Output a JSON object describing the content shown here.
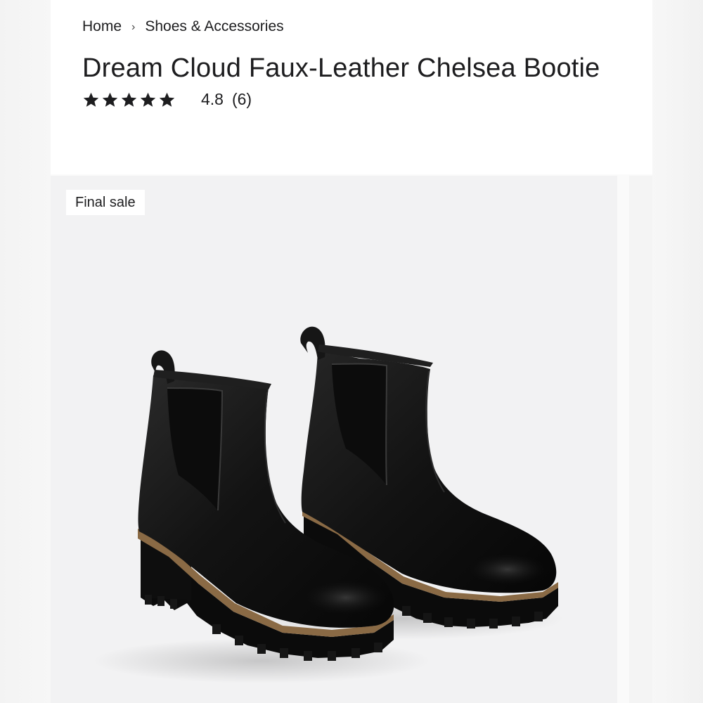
{
  "breadcrumb": {
    "items": [
      "Home",
      "Shoes & Accessories"
    ],
    "separator": "›"
  },
  "product": {
    "title": "Dream Cloud Faux-Leather Chelsea Bootie",
    "rating": "4.8",
    "rating_stars": 5,
    "review_count": "(6)",
    "badge": "Final sale",
    "image_subject": "pair of black faux-leather chelsea boots with elastic side panels, pull tabs and lug soles"
  },
  "colors": {
    "text": "#1d1d1f",
    "boot": "#141414",
    "welt": "#8a6a45",
    "background": "#f2f2f3"
  }
}
